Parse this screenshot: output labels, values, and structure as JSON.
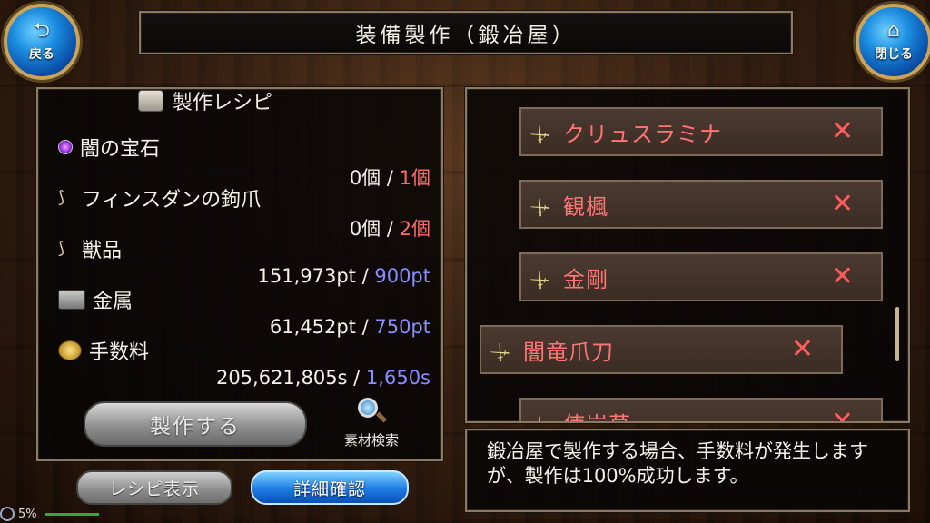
{
  "title": "装備製作（鍛冶屋）",
  "nav": {
    "back_label": "戻る",
    "back_icon": "back-arrow-icon",
    "close_label": "閉じる",
    "close_icon": "home-icon"
  },
  "recipe": {
    "header": "製作レシピ",
    "materials": [
      {
        "name": "闇の宝石",
        "owned": "0個",
        "sep": " / ",
        "required": "1個",
        "required_color": "red",
        "icon": "gem-icon"
      },
      {
        "name": "フィンスダンの鉤爪",
        "owned": "0個",
        "sep": " / ",
        "required": "2個",
        "required_color": "red",
        "icon": "claw-icon"
      },
      {
        "name": "獣品",
        "owned": "151,973pt",
        "sep": " / ",
        "required": "900pt",
        "required_color": "blue",
        "icon": "claw-icon"
      },
      {
        "name": "金属",
        "owned": "61,452pt",
        "sep": " / ",
        "required": "750pt",
        "required_color": "blue",
        "icon": "metal-icon"
      },
      {
        "name": "手数料",
        "owned": "205,621,805s",
        "sep": " / ",
        "required": "1,650s",
        "required_color": "blue",
        "icon": "coin-icon"
      }
    ],
    "make_button": "製作する",
    "search_button": "素材検索"
  },
  "bottom_buttons": {
    "recipe_view": "レシピ表示",
    "detail": "詳細確認"
  },
  "equipment_list": [
    {
      "name": "クリュスラミナ",
      "status_icon": "x-mark-icon"
    },
    {
      "name": "観楓",
      "status_icon": "x-mark-icon"
    },
    {
      "name": "金剛",
      "status_icon": "x-mark-icon"
    },
    {
      "name": "闇竜爪刀",
      "status_icon": "x-mark-icon"
    },
    {
      "name": "使岩草",
      "status_icon": "x-mark-icon"
    }
  ],
  "message": "鍛冶屋で製作する場合、手数料が発生しますが、製作は100%成功します。",
  "status": {
    "battery": "5%"
  },
  "colors": {
    "red": "#ff6b6b",
    "blue": "#8a8dff",
    "item_text": "#ff7474",
    "accent_gold": "#c9a45a"
  }
}
